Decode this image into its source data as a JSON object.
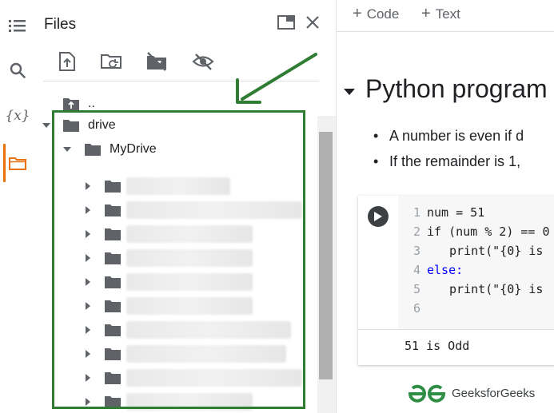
{
  "rail": {
    "items": [
      {
        "name": "toc",
        "icon": "table-of-contents-icon"
      },
      {
        "name": "search",
        "icon": "search-icon"
      },
      {
        "name": "variables",
        "icon": "variables-icon",
        "glyph": "{x}"
      },
      {
        "name": "files",
        "icon": "folder-icon",
        "active": true
      }
    ]
  },
  "files": {
    "title": "Files",
    "toolbar": [
      "upload-icon",
      "refresh-folder-icon",
      "unmount-drive-icon",
      "hide-files-icon"
    ],
    "tree": {
      "parent": "..",
      "drive": "drive",
      "mydrive": "MyDrive",
      "hidden_subfolder_count": 10
    }
  },
  "notebook": {
    "toolbar": {
      "code_label": "Code",
      "text_label": "Text"
    },
    "heading": "Python program",
    "bullets": [
      "A number is even if d",
      "If the remainder is 1,"
    ],
    "code": {
      "line_numbers": [
        "1",
        "2",
        "3",
        "4",
        "5",
        "6"
      ],
      "lines": [
        "num = 51",
        "if (num % 2) == 0",
        "print(\"{0} is",
        "else:",
        "print(\"{0} is",
        ""
      ]
    },
    "output": "51 is Odd"
  },
  "watermark": {
    "text": "GeeksforGeeks"
  },
  "colors": {
    "accent": "#e8710a",
    "annotation": "#2e7d32",
    "gfg": "#2f8d46"
  }
}
